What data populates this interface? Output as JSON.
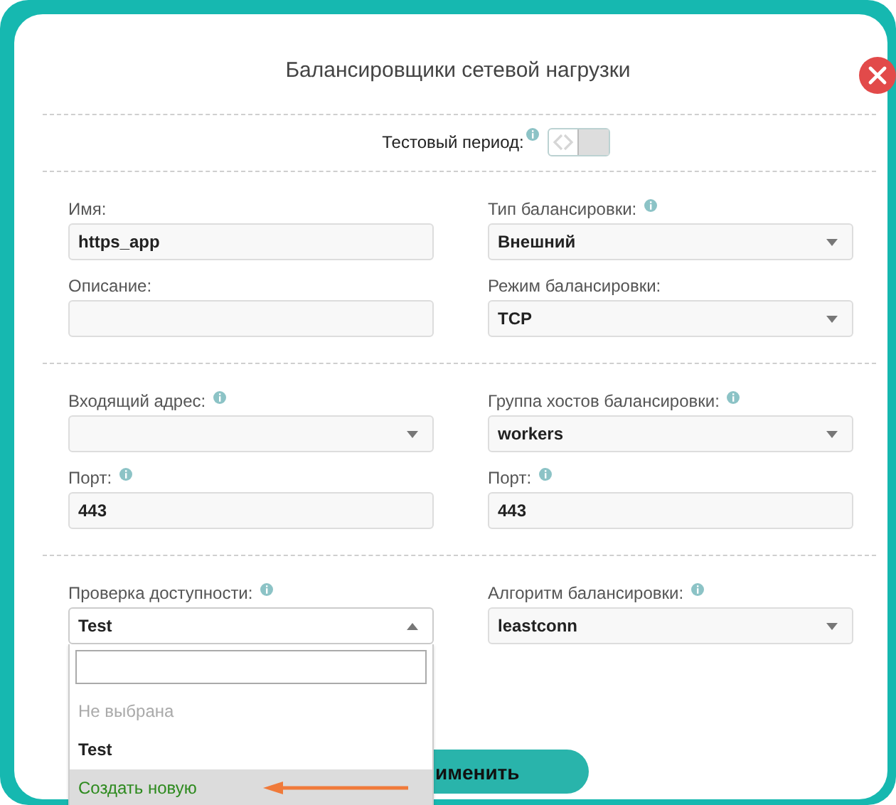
{
  "dialog": {
    "title": "Балансировщики сетевой нагрузки"
  },
  "trial": {
    "label": "Тестовый период:",
    "info": true,
    "on": false
  },
  "sections": [
    {
      "fields": [
        {
          "label": "Имя:",
          "info": false,
          "kind": "text",
          "value": "https_app"
        },
        {
          "label": "Тип балансировки:",
          "info": true,
          "kind": "select",
          "value": "Внешний"
        },
        {
          "label": "Описание:",
          "info": false,
          "kind": "text"
        },
        {
          "label": "Режим балансировки:",
          "info": false,
          "kind": "select",
          "value": "TCP"
        }
      ]
    },
    {
      "fields": [
        {
          "label": "Входящий адрес:",
          "info": true,
          "kind": "select"
        },
        {
          "label": "Группа хостов балансировки:",
          "info": true,
          "kind": "select",
          "value": "workers"
        },
        {
          "label": "Порт:",
          "info": true,
          "kind": "text",
          "value": "443"
        },
        {
          "label": "Порт:",
          "info": true,
          "kind": "text",
          "value": "443"
        }
      ]
    },
    {
      "fields": [
        {
          "label": "Проверка доступности:",
          "info": true,
          "kind": "select",
          "value": "Test",
          "expanded": true,
          "options": [
            {
              "label": "Не выбрана",
              "kind": "none",
              "selected": false,
              "highlighted": false
            },
            {
              "label": "Test",
              "kind": "option",
              "selected": true,
              "highlighted": false
            },
            {
              "label": "Создать новую",
              "kind": "create",
              "selected": false,
              "highlighted": true
            }
          ]
        },
        {
          "label": "Алгоритм балансировки:",
          "info": true,
          "kind": "select",
          "value": "leastconn"
        }
      ],
      "button": "именить"
    }
  ]
}
